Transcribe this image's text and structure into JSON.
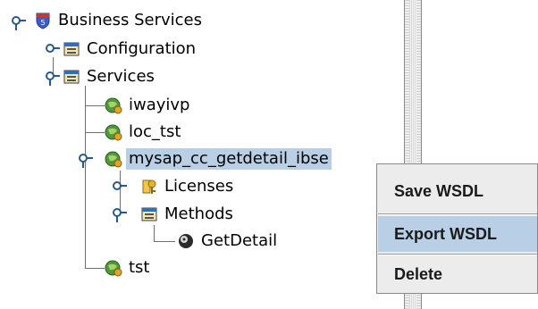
{
  "tree": {
    "root": {
      "label": "Business Services",
      "icon": "business-services-shield-icon"
    },
    "configuration": {
      "label": "Configuration",
      "icon": "window-config-icon"
    },
    "services": {
      "label": "Services",
      "icon": "window-services-icon"
    },
    "service_items": [
      {
        "label": "iwayivp",
        "icon": "service-globe-icon"
      },
      {
        "label": "loc_tst",
        "icon": "service-globe-icon"
      },
      {
        "label": "mysap_cc_getdetail_ibse",
        "icon": "service-globe-icon",
        "selected": true
      },
      {
        "label": "tst",
        "icon": "service-globe-icon"
      }
    ],
    "licenses": {
      "label": "Licenses",
      "icon": "licenses-key-icon"
    },
    "methods": {
      "label": "Methods",
      "icon": "window-methods-icon"
    },
    "getdetail": {
      "label": "GetDetail",
      "icon": "method-disc-icon"
    }
  },
  "context_menu": {
    "items": [
      {
        "label": "Save WSDL"
      },
      {
        "label": "Export WSDL",
        "highlighted": true
      },
      {
        "label": "Delete"
      }
    ]
  },
  "colors": {
    "selection": "#b8cfe5",
    "connector": "#2a5a8a",
    "menu_background": "#ececec"
  }
}
